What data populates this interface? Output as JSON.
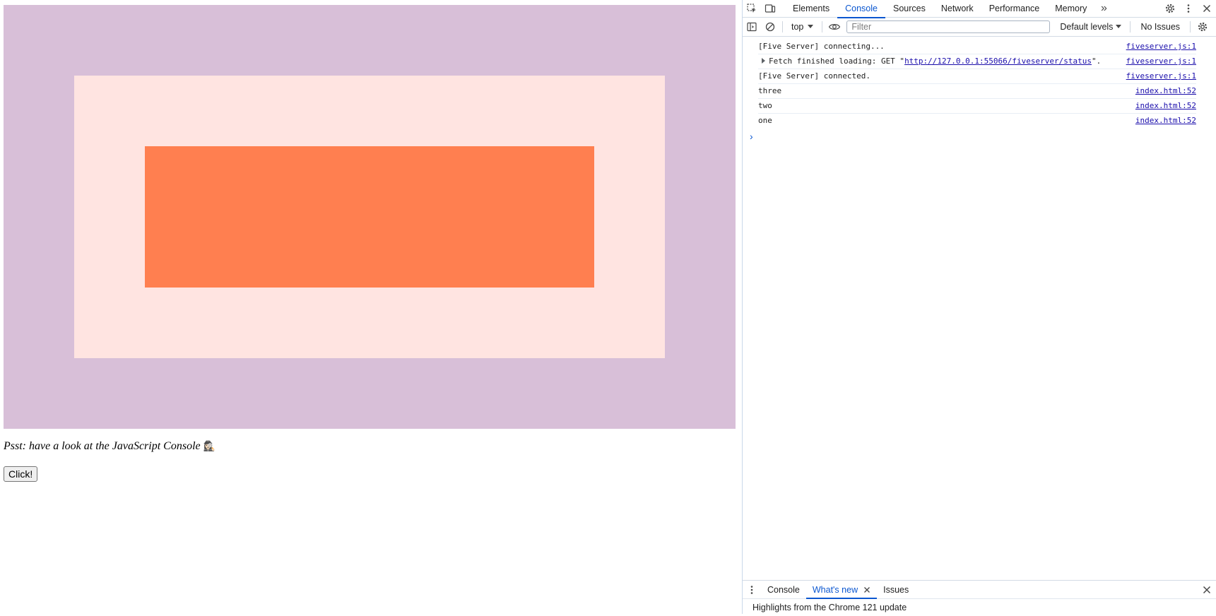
{
  "page": {
    "boxes": {
      "outer_color": "#d8bfd8",
      "middle_color": "#ffe4e1",
      "inner_color": "#ff7f50"
    },
    "psst_text": "Psst: have a look at the JavaScript Console",
    "psst_emoji": "🕵🏻‍♀️",
    "button_label": "Click!"
  },
  "devtools": {
    "tabs": [
      {
        "label": "Elements"
      },
      {
        "label": "Console"
      },
      {
        "label": "Sources"
      },
      {
        "label": "Network"
      },
      {
        "label": "Performance"
      },
      {
        "label": "Memory"
      }
    ],
    "active_tab": "Console",
    "more_tabs_glyph": "»",
    "toolbar": {
      "context": "top",
      "filter_placeholder": "Filter",
      "levels": "Default levels",
      "issues": "No Issues"
    },
    "messages": [
      {
        "text": "[Five Server] connecting...",
        "source": "fiveserver.js:1"
      },
      {
        "prefix": "Fetch finished loading: GET \"",
        "link": "http://127.0.0.1:55066/fiveserver/status",
        "suffix": "\".",
        "source": "fiveserver.js:1"
      },
      {
        "text": "[Five Server] connected.",
        "source": "fiveserver.js:1"
      },
      {
        "text": "three",
        "source": "index.html:52"
      },
      {
        "text": "two",
        "source": "index.html:52"
      },
      {
        "text": "one",
        "source": "index.html:52"
      }
    ],
    "prompt_glyph": "›",
    "drawer": {
      "tabs": [
        {
          "label": "Console"
        },
        {
          "label": "What's new"
        },
        {
          "label": "Issues"
        }
      ],
      "active_tab": "What's new",
      "content": "Highlights from the Chrome 121 update"
    },
    "accent_color": "#0b57d0"
  }
}
